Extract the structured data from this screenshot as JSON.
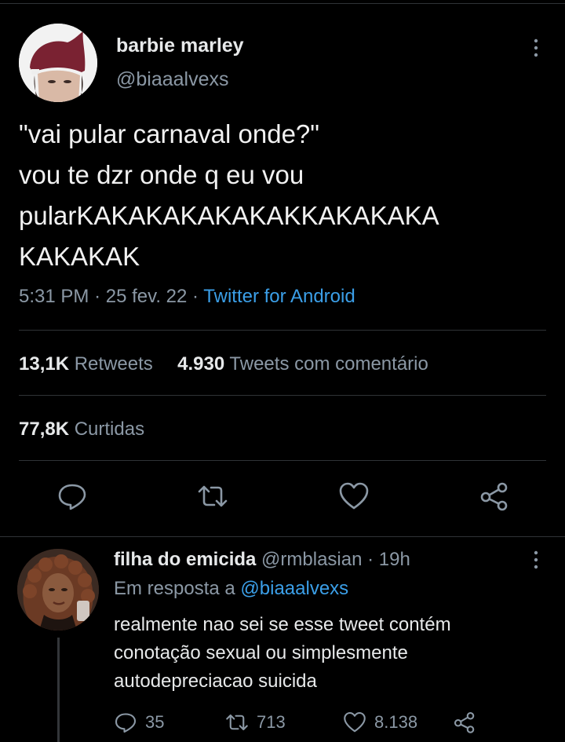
{
  "tweet": {
    "display_name": "barbie marley",
    "handle": "@biaaalvexs",
    "text": "\"vai pular carnaval onde?\"\nvou te dzr onde q eu vou\npularKAKAKAKAKAKAKKAKAKAKA\nKAKAKAK",
    "time": "5:31 PM",
    "date": "25 fev. 22",
    "source": "Twitter for Android",
    "retweets_count": "13,1K",
    "retweets_label": "Retweets",
    "quotes_count": "4.930",
    "quotes_label": "Tweets com comentário",
    "likes_count": "77,8K",
    "likes_label": "Curtidas",
    "actions": [
      "comment-icon",
      "retweet-icon",
      "heart-icon",
      "share-icon"
    ]
  },
  "reply": {
    "display_name": "filha do emicida",
    "handle": "@rmblasian",
    "time": "19h",
    "reply_prefix": "Em resposta a",
    "reply_mention": "@biaaalvexs",
    "text": "realmente nao sei se esse tweet contém\nconotação sexual ou simplesmente\nautodepreciacao suicida",
    "comments": "35",
    "retweets": "713",
    "likes": "8.138"
  },
  "colors": {
    "background": "#000000",
    "primary_text": "#e7e9ea",
    "secondary_text": "#8b98a5",
    "link": "#3b9fe8",
    "divider": "#2f3336"
  }
}
